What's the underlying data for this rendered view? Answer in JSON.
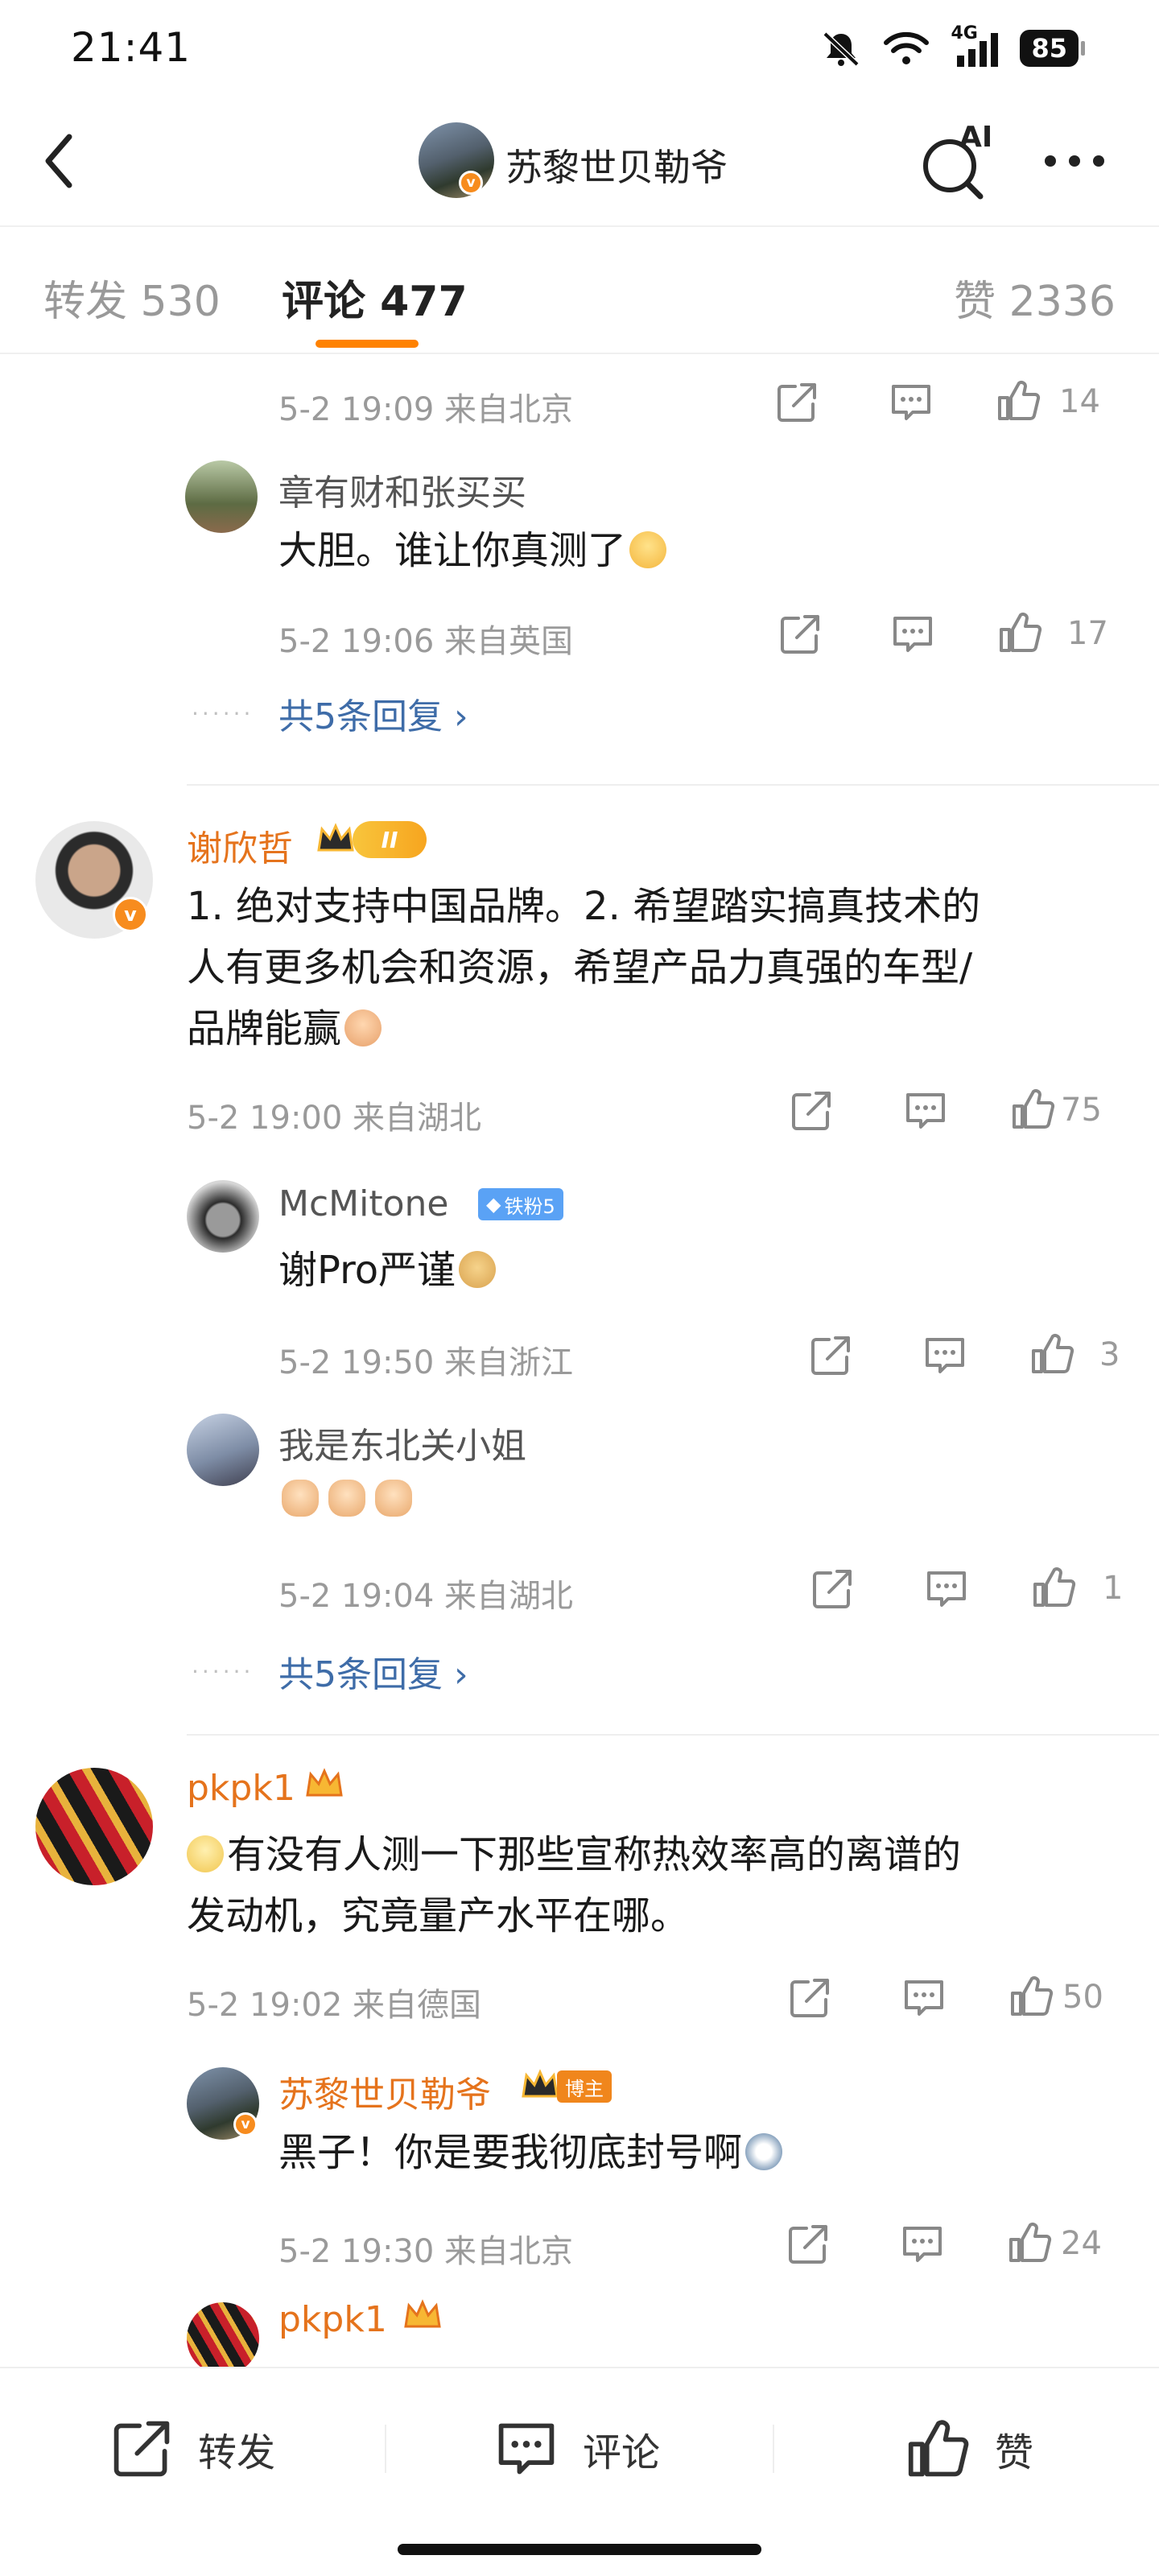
{
  "status_bar": {
    "time": "21:41",
    "battery": "85",
    "network": "4G"
  },
  "nav": {
    "title": "苏黎世贝勒爷",
    "back_icon": "chevron-left-icon",
    "ai_icon": "ai-search-icon",
    "more_icon": "more-icon",
    "ai_label": "AI"
  },
  "tabs": [
    {
      "label": "转发 530"
    },
    {
      "label": "评论 477"
    },
    {
      "label": "赞 2336"
    }
  ],
  "accent_color": "#ff8200",
  "comments": {
    "c0": {
      "meta": "5-2 19:09  来自北京",
      "likes": "14"
    },
    "r1": {
      "name": "章有财和张买买",
      "text": "大胆。谁让你真测了",
      "meta": "5-2 19:06  来自英国",
      "likes": "17"
    },
    "more1": {
      "label": "共5条回复 ›",
      "dots": "······"
    },
    "c2": {
      "name": "谢欣哲",
      "level": "II",
      "lines": [
        "1. 绝对支持中国品牌。2. 希望踏实搞真技术的",
        "人有更多机会和资源，希望产品力真强的车型/",
        "品牌能赢"
      ],
      "meta": "5-2 19:00  来自湖北",
      "likes": "75"
    },
    "r2a": {
      "name": "McMitone",
      "fan_badge": "铁粉5",
      "text": "谢Pro严谨",
      "meta": "5-2 19:50  来自浙江",
      "likes": "3"
    },
    "r2b": {
      "name": "我是东北关小姐",
      "meta": "5-2 19:04  来自湖北",
      "likes": "1"
    },
    "more2": {
      "label": "共5条回复 ›",
      "dots": "······"
    },
    "c3": {
      "name": "pkpk1",
      "lines": [
        "有没有人测一下那些宣称热效率高的离谱的",
        "发动机，究竟量产水平在哪。"
      ],
      "meta": "5-2 19:02  来自德国",
      "likes": "50"
    },
    "r3a": {
      "name": "苏黎世贝勒爷",
      "host_badge": "博主",
      "text": "黑子！你是要我彻底封号啊",
      "meta": "5-2 19:30  来自北京",
      "likes": "24"
    },
    "r3b": {
      "name": "pkpk1"
    }
  },
  "bottom_bar": {
    "repost": "转发",
    "comment": "评论",
    "like": "赞"
  }
}
